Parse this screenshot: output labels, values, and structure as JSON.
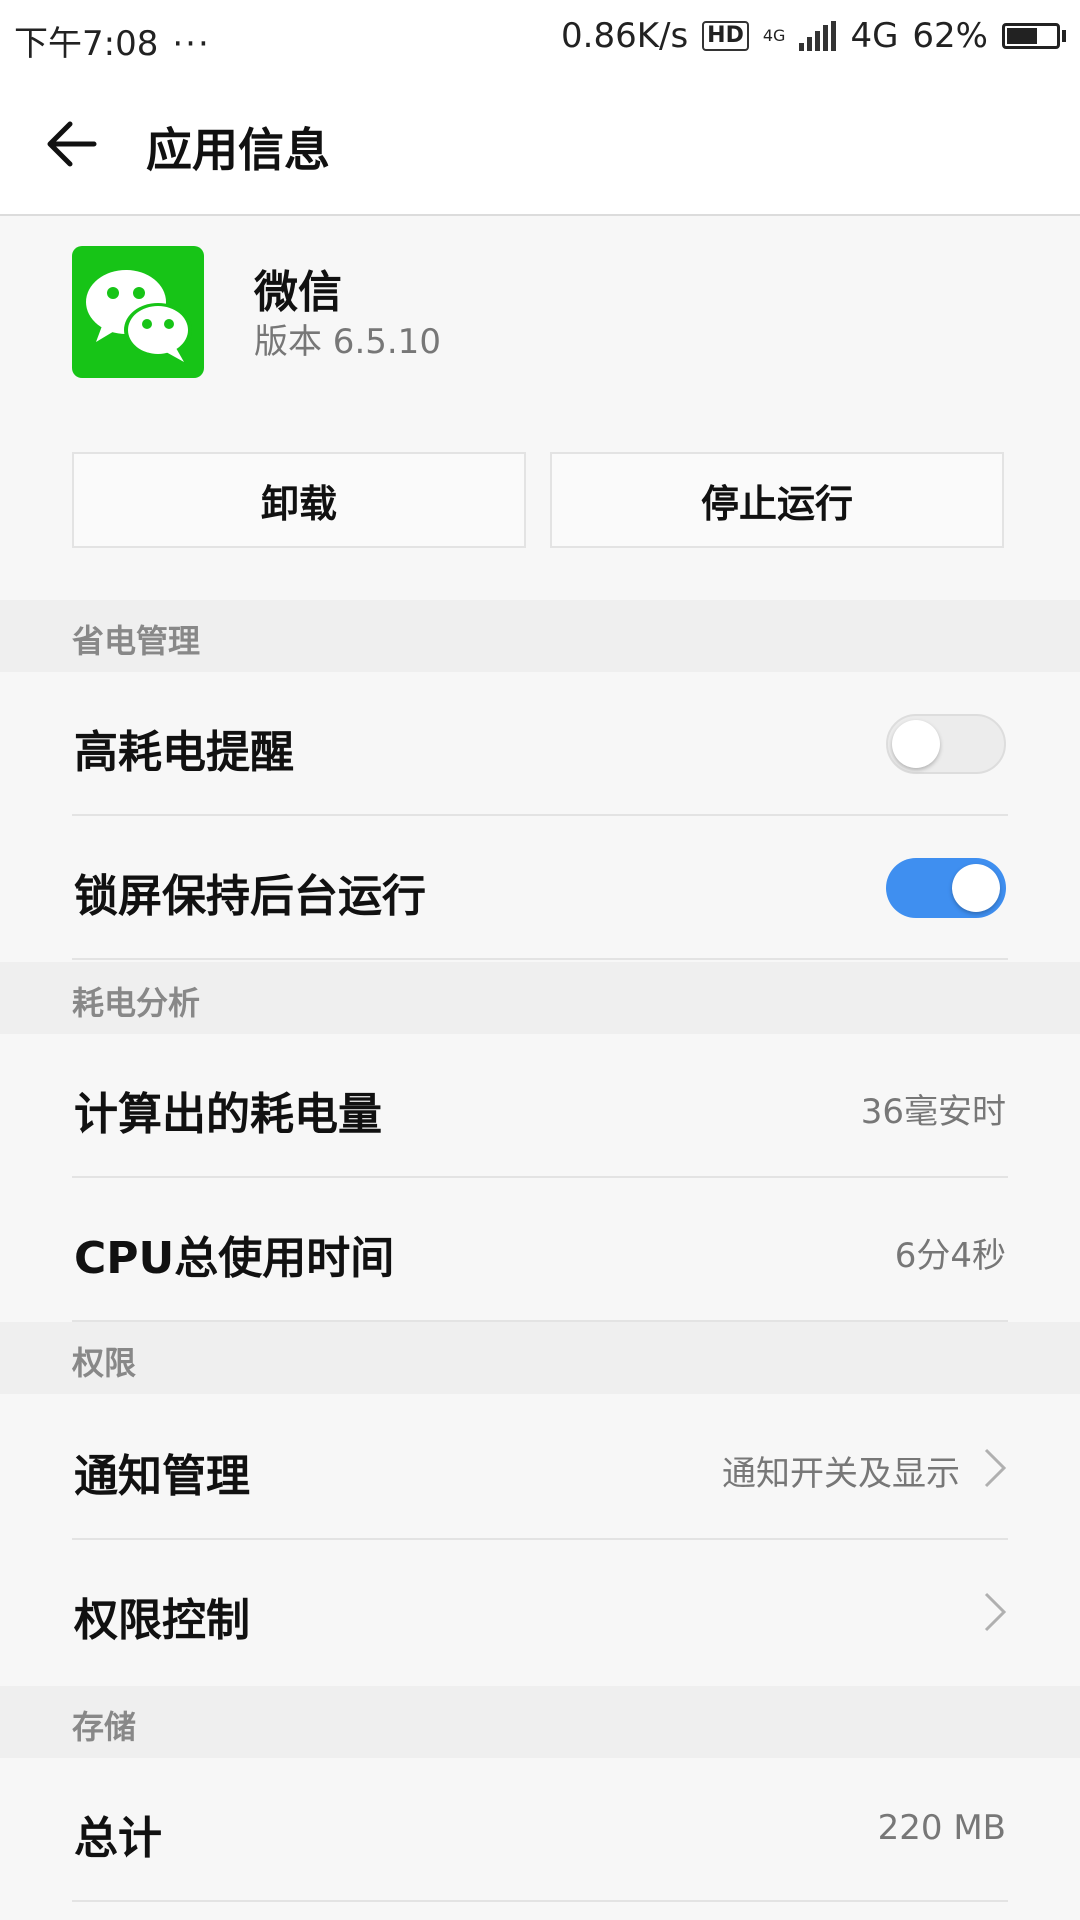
{
  "status_bar": {
    "time": "下午7:08",
    "dots": "···",
    "speed": "0.86K/s",
    "hd": "HD",
    "network_small": "4G",
    "network": "4G",
    "battery": "62%"
  },
  "title_bar": {
    "title": "应用信息"
  },
  "app": {
    "name": "微信",
    "version": "版本 6.5.10",
    "icon_color": "#17c417"
  },
  "buttons": {
    "uninstall": "卸载",
    "force_stop": "停止运行"
  },
  "sections": {
    "power_management": {
      "header": "省电管理",
      "high_power_alert": {
        "label": "高耗电提醒",
        "enabled": false
      },
      "keep_running_locked": {
        "label": "锁屏保持后台运行",
        "enabled": true
      }
    },
    "power_analysis": {
      "header": "耗电分析",
      "computed_power": {
        "label": "计算出的耗电量",
        "value": "36毫安时"
      },
      "cpu_time": {
        "label": "CPU总使用时间",
        "value": "6分4秒"
      }
    },
    "permissions": {
      "header": "权限",
      "notifications": {
        "label": "通知管理",
        "value": "通知开关及显示"
      },
      "permission_control": {
        "label": "权限控制"
      }
    },
    "storage": {
      "header": "存储",
      "total": {
        "label": "总计",
        "value": "220 MB"
      }
    }
  },
  "colors": {
    "toggle_on": "#3f8ff0",
    "background": "#f7f7f7",
    "section_header": "#efefef"
  }
}
